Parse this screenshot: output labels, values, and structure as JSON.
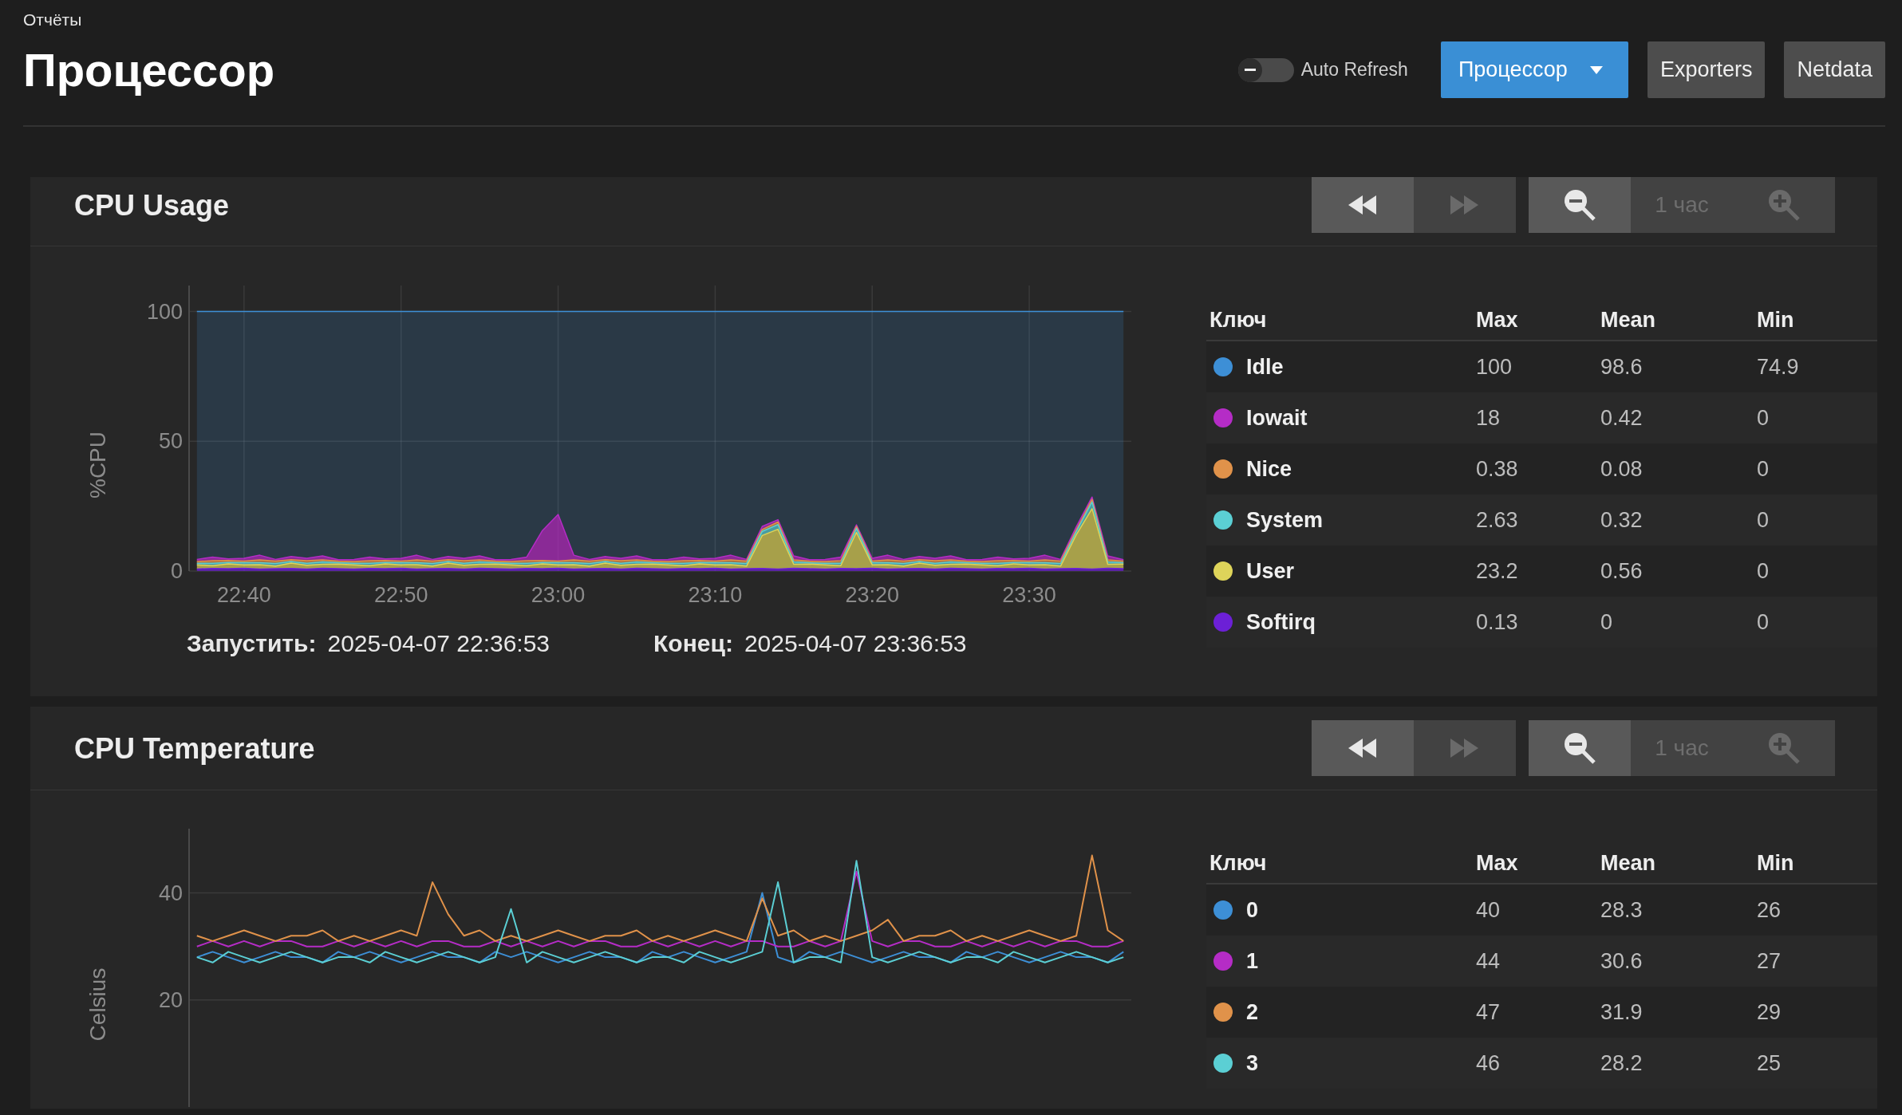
{
  "breadcrumb": "Отчёты",
  "title": "Процессор",
  "auto_refresh": {
    "label": "Auto Refresh",
    "on": false
  },
  "header_buttons": [
    {
      "kind": "dropdown",
      "label": "Процессор"
    },
    {
      "kind": "plain",
      "label": "Exporters"
    },
    {
      "kind": "plain",
      "label": "Netdata"
    }
  ],
  "panels": [
    {
      "title": "CPU Usage",
      "nav": [
        {
          "kind": "back",
          "disabled": false
        },
        {
          "kind": "forward",
          "disabled": true
        }
      ],
      "zoom": [
        {
          "kind": "zoom_out",
          "disabled": false
        },
        {
          "kind": "range",
          "label": "1 час"
        },
        {
          "kind": "zoom_in",
          "disabled": true
        }
      ],
      "chart_data": {
        "type": "area",
        "ylabel": "%CPU",
        "stacked": true,
        "grid": true,
        "categories": [
          null,
          null,
          null,
          "22:40",
          null,
          null,
          null,
          null,
          null,
          null,
          null,
          null,
          null,
          "22:50",
          null,
          null,
          null,
          null,
          null,
          null,
          null,
          null,
          null,
          "23:00",
          null,
          null,
          null,
          null,
          null,
          null,
          null,
          null,
          null,
          "23:10",
          null,
          null,
          null,
          null,
          null,
          null,
          null,
          null,
          null,
          "23:20",
          null,
          null,
          null,
          null,
          null,
          null,
          null,
          null,
          null,
          "23:30",
          null,
          null,
          null,
          null,
          null,
          null
        ],
        "ylim": [
          0,
          110
        ],
        "yticks": [
          0,
          50,
          100
        ],
        "series": [
          {
            "name": "Idle",
            "color": "#3d8fd6",
            "values": [
              95.5,
              94.6,
              95.3,
              95.1,
              93.9,
              95.5,
              94.4,
              95.1,
              94.2,
              95.6,
              95.5,
              94.6,
              95.3,
              95.1,
              93.9,
              95.5,
              94.4,
              95.1,
              94.2,
              95.6,
              95.5,
              94.6,
              84.4,
              78.2,
              93.9,
              95.5,
              94.4,
              95.1,
              94.2,
              95.6,
              95.5,
              94.6,
              95.3,
              95.1,
              93.9,
              95.5,
              82.8,
              80.2,
              94.2,
              95.6,
              95.5,
              94.6,
              82.2,
              95.1,
              93.9,
              95.5,
              94.4,
              95.1,
              94.2,
              95.6,
              95.5,
              94.6,
              95.3,
              95.1,
              93.9,
              95.5,
              82.9,
              71.5,
              94.2,
              95.6
            ]
          },
          {
            "name": "Iowait",
            "color": "#b52cc6",
            "values": [
              0.8,
              1.4,
              0.6,
              1.1,
              1.8,
              0.7,
              1.2,
              0.9,
              1.5,
              0.6,
              0.8,
              1.4,
              0.6,
              1.1,
              1.8,
              0.7,
              1.2,
              0.9,
              1.5,
              0.6,
              0.8,
              1.4,
              11.5,
              18,
              1.8,
              0.7,
              1.2,
              0.9,
              1.5,
              0.6,
              0.8,
              1.4,
              0.6,
              1.1,
              1.8,
              0.7,
              1.2,
              0.9,
              1.5,
              0.6,
              0.8,
              1.4,
              0.6,
              1.1,
              1.8,
              0.7,
              1.2,
              0.9,
              1.5,
              0.6,
              0.8,
              1.4,
              0.6,
              1.1,
              1.8,
              0.7,
              1.2,
              0.9,
              1.5,
              0.6
            ]
          },
          {
            "name": "Nice",
            "color": "#e0924a",
            "values": [
              0.7,
              1.0,
              0.8,
              0.6,
              1.1,
              0.9,
              0.7,
              1.0,
              0.8,
              0.6,
              0.7,
              1.0,
              0.8,
              0.6,
              1.1,
              0.9,
              0.7,
              1.0,
              0.8,
              0.6,
              0.7,
              1.0,
              0.8,
              0.6,
              1.1,
              0.9,
              0.7,
              1.0,
              0.8,
              0.6,
              0.7,
              1.0,
              0.8,
              0.6,
              1.1,
              0.9,
              0.7,
              1.0,
              0.8,
              0.6,
              0.7,
              1.0,
              0.8,
              0.6,
              1.1,
              0.9,
              0.7,
              1.0,
              0.8,
              0.6,
              0.7,
              1.0,
              0.8,
              0.6,
              1.1,
              0.9,
              0.7,
              1.0,
              0.8,
              0.6
            ]
          },
          {
            "name": "System",
            "color": "#5bcfd4",
            "values": [
              0.6,
              0.9,
              0.5,
              0.8,
              0.7,
              1.0,
              0.6,
              0.8,
              0.9,
              0.5,
              0.6,
              0.9,
              0.5,
              0.8,
              0.7,
              1.0,
              0.6,
              0.8,
              0.9,
              0.5,
              0.6,
              0.9,
              0.5,
              0.8,
              0.7,
              1.0,
              0.6,
              0.8,
              0.9,
              0.5,
              0.6,
              0.9,
              0.5,
              0.8,
              0.7,
              1.0,
              1.6,
              1.8,
              0.9,
              0.5,
              0.6,
              0.9,
              1.5,
              0.8,
              0.7,
              1.0,
              0.6,
              0.8,
              0.9,
              0.5,
              0.6,
              0.9,
              0.5,
              0.8,
              0.7,
              1.0,
              1.2,
              2.6,
              0.9,
              0.5
            ]
          },
          {
            "name": "User",
            "color": "#ded45a",
            "values": [
              1.6,
              1.1,
              1.9,
              1.3,
              1.7,
              1.0,
              2.1,
              1.4,
              1.5,
              1.8,
              1.6,
              1.1,
              1.9,
              1.3,
              1.7,
              1.0,
              2.1,
              1.4,
              1.5,
              1.8,
              1.6,
              1.1,
              1.9,
              1.3,
              1.7,
              1.0,
              2.1,
              1.4,
              1.5,
              1.8,
              1.6,
              1.1,
              1.9,
              1.3,
              1.7,
              1.0,
              12.7,
              15.3,
              1.5,
              1.8,
              1.6,
              1.1,
              14,
              1.3,
              1.7,
              1.0,
              2.1,
              1.4,
              1.5,
              1.8,
              1.6,
              1.1,
              1.9,
              1.3,
              1.7,
              1.0,
              13,
              23.2,
              1.5,
              1.8
            ]
          },
          {
            "name": "Softirq",
            "color": "#6c20d6",
            "values": [
              0.8,
              1.0,
              0.9,
              1.1,
              0.8,
              0.9,
              1.0,
              0.8,
              1.1,
              0.9,
              0.8,
              1.0,
              0.9,
              1.1,
              0.8,
              0.9,
              1.0,
              0.8,
              1.1,
              0.9,
              0.8,
              1.0,
              0.9,
              1.1,
              0.8,
              0.9,
              1.0,
              0.8,
              1.1,
              0.9,
              0.8,
              1.0,
              0.9,
              1.1,
              0.8,
              0.9,
              1.0,
              0.8,
              1.1,
              0.9,
              0.8,
              1.0,
              0.9,
              1.1,
              0.8,
              0.9,
              1.0,
              0.8,
              1.1,
              0.9,
              0.8,
              1.0,
              0.9,
              1.1,
              0.8,
              0.9,
              1.0,
              0.8,
              1.1,
              0.9
            ]
          }
        ]
      },
      "range_info": [
        {
          "label": "Запустить:",
          "value": "2025-04-07 22:36:53"
        },
        {
          "label": "Конец:",
          "value": "2025-04-07 23:36:53"
        }
      ],
      "legend": {
        "columns": [
          "Ключ",
          "Max",
          "Mean",
          "Min"
        ],
        "rows": [
          {
            "max": "100",
            "mean": "98.6",
            "min": "74.9"
          },
          {
            "max": "18",
            "mean": "0.42",
            "min": "0"
          },
          {
            "max": "0.38",
            "mean": "0.08",
            "min": "0"
          },
          {
            "max": "2.63",
            "mean": "0.32",
            "min": "0"
          },
          {
            "max": "23.2",
            "mean": "0.56",
            "min": "0"
          },
          {
            "max": "0.13",
            "mean": "0",
            "min": "0"
          }
        ]
      }
    },
    {
      "title": "CPU Temperature",
      "nav": [
        {
          "kind": "back",
          "disabled": false
        },
        {
          "kind": "forward",
          "disabled": true
        }
      ],
      "zoom": [
        {
          "kind": "zoom_out",
          "disabled": false
        },
        {
          "kind": "range",
          "label": "1 час"
        },
        {
          "kind": "zoom_in",
          "disabled": true
        }
      ],
      "chart_data": {
        "type": "line",
        "ylabel": "Celsius",
        "grid": true,
        "ylim": [
          0,
          52
        ],
        "yticks": [
          20,
          40
        ],
        "series": [
          {
            "name": "0",
            "color": "#3d8fd6",
            "values": [
              28,
              29,
              28,
              27,
              28,
              29,
              28,
              28,
              27,
              29,
              28,
              29,
              28,
              27,
              28,
              29,
              28,
              28,
              27,
              29,
              28,
              29,
              28,
              27,
              28,
              29,
              28,
              28,
              27,
              29,
              28,
              29,
              28,
              27,
              28,
              29,
              40,
              28,
              27,
              29,
              28,
              29,
              28,
              27,
              28,
              29,
              28,
              28,
              27,
              29,
              28,
              29,
              28,
              27,
              28,
              29,
              28,
              28,
              27,
              29
            ]
          },
          {
            "name": "1",
            "color": "#b52cc6",
            "values": [
              30,
              31,
              30,
              31,
              30,
              31,
              31,
              30,
              30,
              31,
              30,
              31,
              30,
              31,
              30,
              31,
              31,
              30,
              30,
              31,
              30,
              31,
              30,
              31,
              30,
              31,
              31,
              30,
              30,
              31,
              30,
              31,
              30,
              31,
              30,
              31,
              31,
              30,
              30,
              31,
              30,
              31,
              44,
              31,
              30,
              31,
              31,
              30,
              30,
              31,
              30,
              31,
              30,
              31,
              30,
              31,
              31,
              30,
              30,
              31
            ]
          },
          {
            "name": "2",
            "color": "#e0924a",
            "values": [
              32,
              31,
              32,
              33,
              32,
              31,
              32,
              32,
              33,
              31,
              32,
              31,
              32,
              33,
              32,
              42,
              36,
              32,
              33,
              31,
              32,
              31,
              32,
              33,
              32,
              31,
              32,
              32,
              33,
              31,
              32,
              31,
              32,
              33,
              32,
              31,
              39,
              32,
              33,
              31,
              32,
              31,
              32,
              33,
              35,
              31,
              32,
              32,
              33,
              31,
              32,
              31,
              32,
              33,
              32,
              31,
              32,
              47,
              33,
              31
            ]
          },
          {
            "name": "3",
            "color": "#5bcfd4",
            "values": [
              28,
              27,
              29,
              28,
              27,
              28,
              29,
              28,
              27,
              28,
              28,
              27,
              29,
              28,
              27,
              28,
              29,
              28,
              27,
              28,
              37,
              27,
              29,
              28,
              27,
              28,
              29,
              28,
              27,
              28,
              28,
              27,
              29,
              28,
              27,
              28,
              29,
              42,
              27,
              28,
              28,
              27,
              46,
              28,
              27,
              28,
              29,
              28,
              27,
              28,
              28,
              27,
              29,
              28,
              27,
              28,
              29,
              28,
              27,
              28
            ]
          }
        ]
      },
      "legend": {
        "columns": [
          "Ключ",
          "Max",
          "Mean",
          "Min"
        ],
        "rows": [
          {
            "max": "40",
            "mean": "28.3",
            "min": "26"
          },
          {
            "max": "44",
            "mean": "30.6",
            "min": "27"
          },
          {
            "max": "47",
            "mean": "31.9",
            "min": "29"
          },
          {
            "max": "46",
            "mean": "28.2",
            "min": "25"
          }
        ]
      }
    }
  ]
}
